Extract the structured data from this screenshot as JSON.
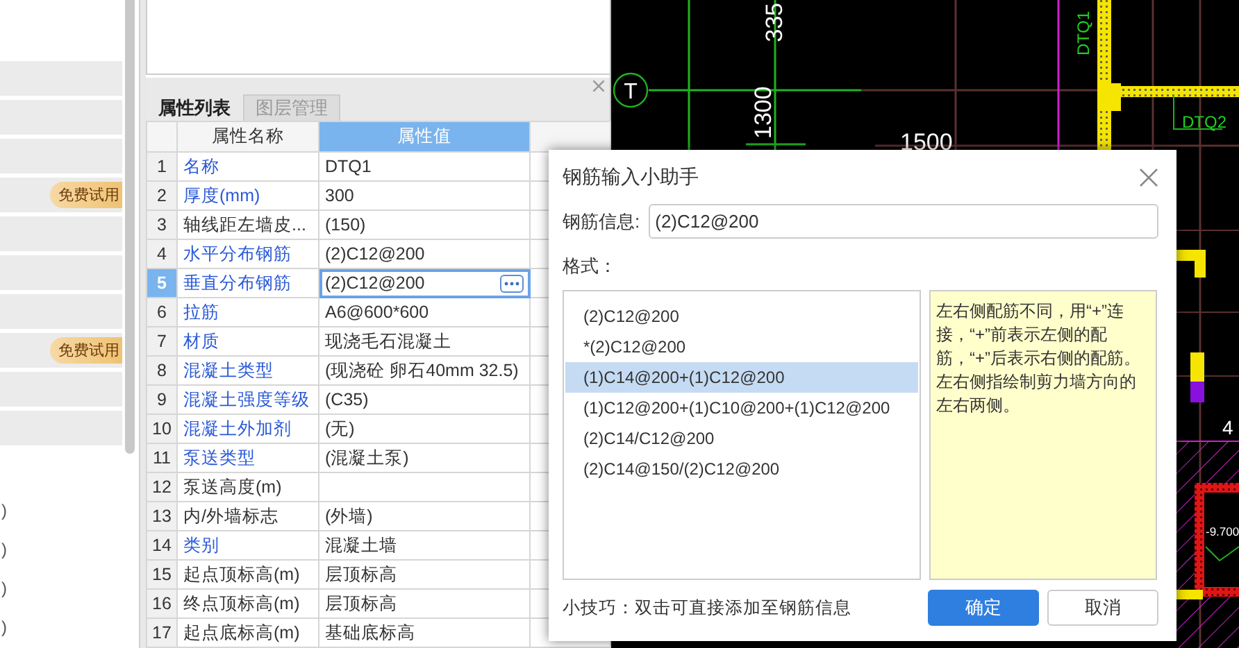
{
  "left_panel": {
    "items": [
      {
        "kind": "plain"
      },
      {
        "kind": "plain"
      },
      {
        "kind": "plain"
      },
      {
        "kind": "badge",
        "badge": "免费试用"
      },
      {
        "kind": "plain"
      },
      {
        "kind": "plain"
      },
      {
        "kind": "plain"
      },
      {
        "kind": "badge",
        "badge": "免费试用"
      },
      {
        "kind": "plain"
      },
      {
        "kind": "plain"
      }
    ],
    "cut_texts": [
      ")",
      ")",
      ")",
      ")"
    ]
  },
  "properties_panel": {
    "tabs": [
      {
        "label": "属性列表",
        "selected": true
      },
      {
        "label": "图层管理",
        "selected": false
      }
    ],
    "columns": [
      "属性名称",
      "属性值"
    ],
    "rows": [
      {
        "index": "1",
        "name": "名称",
        "value": "DTQ1",
        "public": true,
        "selected": false
      },
      {
        "index": "2",
        "name": "厚度(mm)",
        "value": "300",
        "public": true,
        "selected": false
      },
      {
        "index": "3",
        "name": "轴线距左墙皮...",
        "value": "(150)",
        "public": false,
        "selected": false
      },
      {
        "index": "4",
        "name": "水平分布钢筋",
        "value": "(2)C12@200",
        "public": true,
        "selected": false
      },
      {
        "index": "5",
        "name": "垂直分布钢筋",
        "value": "(2)C12@200",
        "public": true,
        "selected": true
      },
      {
        "index": "6",
        "name": "拉筋",
        "value": "A6@600*600",
        "public": true,
        "selected": false
      },
      {
        "index": "7",
        "name": "材质",
        "value": "现浇毛石混凝土",
        "public": true,
        "selected": false
      },
      {
        "index": "8",
        "name": "混凝土类型",
        "value": "(现浇砼 卵石40mm 32.5)",
        "public": true,
        "selected": false
      },
      {
        "index": "9",
        "name": "混凝土强度等级",
        "value": "(C35)",
        "public": true,
        "selected": false
      },
      {
        "index": "10",
        "name": "混凝土外加剂",
        "value": "(无)",
        "public": true,
        "selected": false
      },
      {
        "index": "11",
        "name": "泵送类型",
        "value": "(混凝土泵)",
        "public": true,
        "selected": false
      },
      {
        "index": "12",
        "name": "泵送高度(m)",
        "public": false,
        "selected": false
      },
      {
        "index": "13",
        "name": "内/外墙标志",
        "value": "(外墙)",
        "public": false,
        "selected": false
      },
      {
        "index": "14",
        "name": "类别",
        "value": "混凝土墙",
        "public": true,
        "selected": false
      },
      {
        "index": "15",
        "name": "起点顶标高(m)",
        "value": "层顶标高",
        "public": false,
        "selected": false
      },
      {
        "index": "16",
        "name": "终点顶标高(m)",
        "value": "层顶标高",
        "public": false,
        "selected": false
      },
      {
        "index": "17",
        "name": "起点底标高(m)",
        "value": "基础底标高",
        "public": false,
        "selected": false
      }
    ]
  },
  "cad": {
    "labels": [
      {
        "text": "335"
      },
      {
        "text": "1300"
      },
      {
        "text": "1500"
      },
      {
        "text": "DTQ1"
      },
      {
        "text": "DTQ2"
      },
      {
        "text": "T"
      },
      {
        "text": "4"
      },
      {
        "text": "-9.700"
      }
    ]
  },
  "dialog": {
    "title": "钢筋输入小助手",
    "info_label": "钢筋信息:",
    "info_value": "(2)C12@200",
    "format_label": "格式：",
    "formats": [
      {
        "text": "(2)C12@200",
        "selected": false
      },
      {
        "text": "*(2)C12@200",
        "selected": false
      },
      {
        "text": "(1)C14@200+(1)C12@200",
        "selected": true
      },
      {
        "text": "(1)C12@200+(1)C10@200+(1)C12@200",
        "selected": false
      },
      {
        "text": "(2)C14/C12@200",
        "selected": false
      },
      {
        "text": "(2)C14@150/(2)C12@200",
        "selected": false
      }
    ],
    "help": "左右侧配筋不同，用“+”连接，“+”前表示左侧的配筋，“+”后表示右侧的配筋。左右侧指绘制剪力墙方向的左右两侧。",
    "tip": "小技巧：双击可直接添加至钢筋信息",
    "buttons": [
      {
        "label": "确定",
        "kind": "primary"
      },
      {
        "label": "取消",
        "kind": "secondary"
      }
    ]
  }
}
